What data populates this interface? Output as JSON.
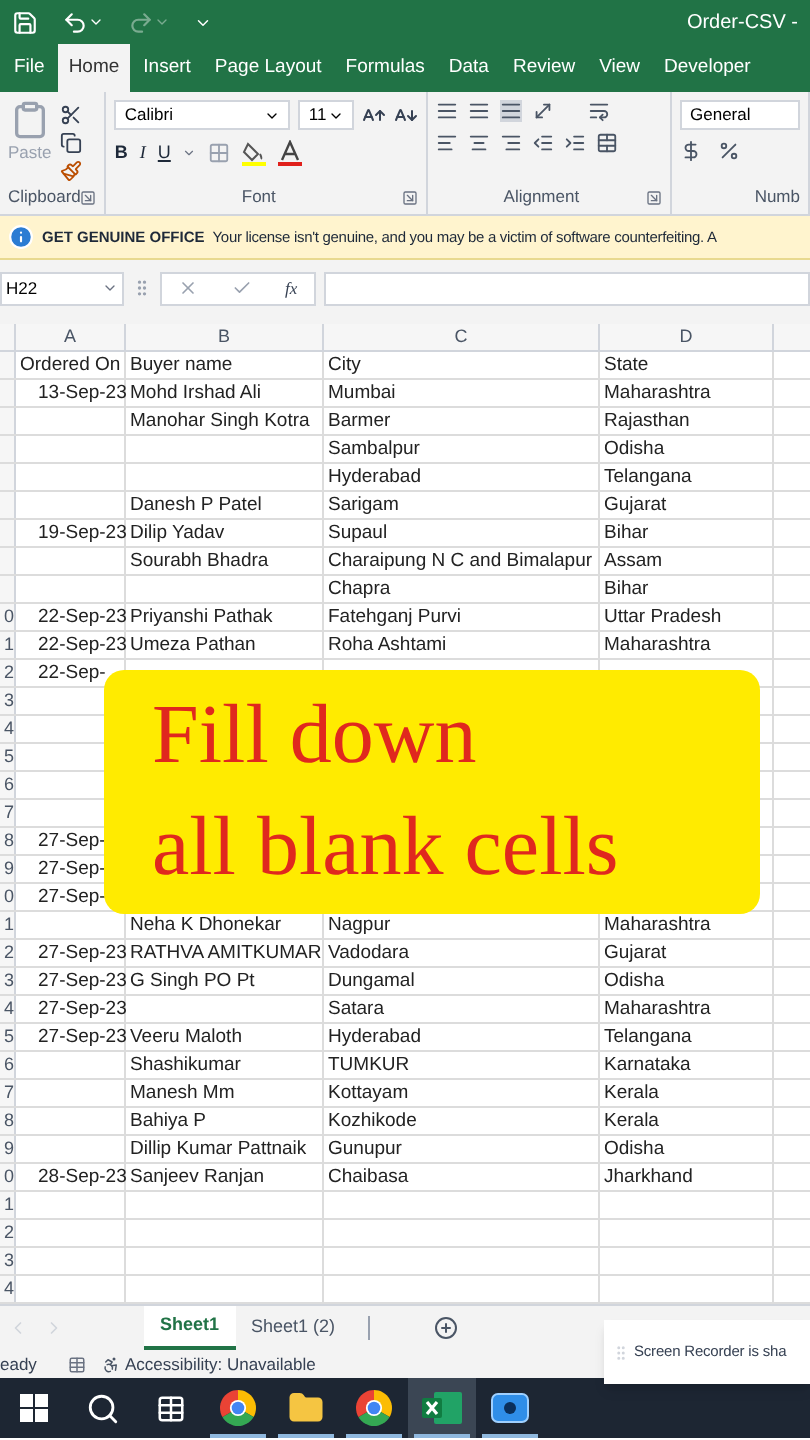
{
  "title_bar": {
    "document_title": "Order-CSV -"
  },
  "ribbon_tabs": [
    {
      "label": "File",
      "selected": false
    },
    {
      "label": "Home",
      "selected": true
    },
    {
      "label": "Insert",
      "selected": false
    },
    {
      "label": "Page Layout",
      "selected": false
    },
    {
      "label": "Formulas",
      "selected": false
    },
    {
      "label": "Data",
      "selected": false
    },
    {
      "label": "Review",
      "selected": false
    },
    {
      "label": "View",
      "selected": false
    },
    {
      "label": "Developer",
      "selected": false
    }
  ],
  "ribbon": {
    "groups": [
      {
        "kind": "clipboard",
        "label": "Clipboard"
      },
      {
        "kind": "font",
        "label": "Font"
      },
      {
        "kind": "alignment",
        "label": "Alignment"
      },
      {
        "kind": "number",
        "label": "Numb"
      }
    ],
    "paste_label": "Paste",
    "font_name": "Calibri",
    "font_size": "11",
    "format_buttons": [
      "B",
      "I",
      "U"
    ],
    "number_format": "General"
  },
  "message_bar": {
    "title": "GET GENUINE OFFICE",
    "text": "Your license isn't genuine, and you may be a victim of software counterfeiting. A"
  },
  "formula_bar": {
    "name_box": "H22",
    "function_label": "fx"
  },
  "sheet": {
    "columns": [
      "A",
      "B",
      "C",
      "D"
    ],
    "rows": [
      {
        "cells": {
          "a": "Ordered On",
          "b": "Buyer name",
          "c": "City",
          "d": "State"
        }
      },
      {
        "cells": {
          "a": "13-Sep-23",
          "b": "Mohd Irshad Ali",
          "c": "Mumbai",
          "d": "Maharashtra"
        }
      },
      {
        "cells": {
          "b": "Manohar Singh Kotra",
          "c": "Barmer",
          "d": "Rajasthan"
        }
      },
      {
        "cells": {
          "c": "Sambalpur",
          "d": "Odisha"
        }
      },
      {
        "cells": {
          "c": "Hyderabad",
          "d": "Telangana"
        }
      },
      {
        "cells": {
          "b": "Danesh P Patel",
          "c": "Sarigam",
          "d": "Gujarat"
        }
      },
      {
        "cells": {
          "a": "19-Sep-23",
          "b": "Dilip Yadav",
          "c": "Supaul",
          "d": "Bihar"
        }
      },
      {
        "cells": {
          "b": "Sourabh Bhadra",
          "c": "Charaipung N C and Bimalapur",
          "d": "Assam"
        }
      },
      {
        "cells": {
          "c": "Chapra",
          "d": "Bihar"
        }
      },
      {
        "label": "0",
        "cells": {
          "a": "22-Sep-23",
          "b": "Priyanshi Pathak",
          "c": "Fatehganj Purvi",
          "d": "Uttar Pradesh"
        }
      },
      {
        "label": "1",
        "cells": {
          "a": "22-Sep-23",
          "b": "Umeza Pathan",
          "c": "Roha Ashtami",
          "d": "Maharashtra"
        }
      },
      {
        "label": "2",
        "cells": {
          "a": "22-Sep-"
        }
      },
      {
        "label": "3",
        "cells": {}
      },
      {
        "label": "4",
        "cells": {}
      },
      {
        "label": "5",
        "cells": {}
      },
      {
        "label": "6",
        "cells": {}
      },
      {
        "label": "7",
        "cells": {}
      },
      {
        "label": "8",
        "cells": {
          "a": "27-Sep-"
        }
      },
      {
        "label": "9",
        "cells": {
          "a": "27-Sep-"
        }
      },
      {
        "label": "0",
        "cells": {
          "a": "27-Sep-"
        }
      },
      {
        "label": "1",
        "cells": {
          "b": "Neha K Dhonekar",
          "c": "Nagpur",
          "d": "Maharashtra"
        }
      },
      {
        "label": "2",
        "cells": {
          "a": "27-Sep-23",
          "b": "RATHVA AMITKUMAR",
          "c": "Vadodara",
          "d": "Gujarat"
        }
      },
      {
        "label": "3",
        "cells": {
          "a": "27-Sep-23",
          "b": "G Singh PO Pt",
          "c": "Dungamal",
          "d": "Odisha"
        }
      },
      {
        "label": "4",
        "cells": {
          "a": "27-Sep-23",
          "c": "Satara",
          "d": "Maharashtra"
        }
      },
      {
        "label": "5",
        "cells": {
          "a": "27-Sep-23",
          "b": "Veeru Maloth",
          "c": "Hyderabad",
          "d": "Telangana"
        }
      },
      {
        "label": "6",
        "cells": {
          "b": "Shashikumar",
          "c": "TUMKUR",
          "d": "Karnataka"
        }
      },
      {
        "label": "7",
        "cells": {
          "b": "Manesh Mm",
          "c": "Kottayam",
          "d": "Kerala"
        }
      },
      {
        "label": "8",
        "cells": {
          "b": "Bahiya P",
          "c": "Kozhikode",
          "d": "Kerala"
        }
      },
      {
        "label": "9",
        "cells": {
          "b": "Dillip Kumar Pattnaik",
          "c": "Gunupur",
          "d": "Odisha"
        }
      },
      {
        "label": "0",
        "cells": {
          "a": "28-Sep-23",
          "b": "Sanjeev Ranjan",
          "c": "Chaibasa",
          "d": "Jharkhand"
        }
      },
      {
        "label": "1",
        "cells": {}
      },
      {
        "label": "2",
        "cells": {}
      },
      {
        "label": "3",
        "cells": {}
      },
      {
        "label": "4",
        "cells": {}
      }
    ]
  },
  "overlay": {
    "lines": [
      "Fill down",
      "all blank cells"
    ]
  },
  "sheet_tabs": [
    {
      "label": "Sheet1",
      "selected": true
    },
    {
      "label": "Sheet1 (2)",
      "selected": false
    }
  ],
  "status_bar": {
    "mode": "eady",
    "accessibility": "Accessibility: Unavailable"
  },
  "notification": {
    "text": "Screen Recorder is sha"
  },
  "taskbar": [
    {
      "kind": "start",
      "running": false,
      "active": false
    },
    {
      "kind": "search",
      "running": false,
      "active": false
    },
    {
      "kind": "task_view",
      "running": false,
      "active": false
    },
    {
      "kind": "chrome",
      "running": true,
      "active": false
    },
    {
      "kind": "files",
      "running": true,
      "active": false
    },
    {
      "kind": "chrome",
      "running": true,
      "active": false
    },
    {
      "kind": "excel",
      "running": true,
      "active": true
    },
    {
      "kind": "recorder",
      "running": true,
      "active": false
    }
  ]
}
